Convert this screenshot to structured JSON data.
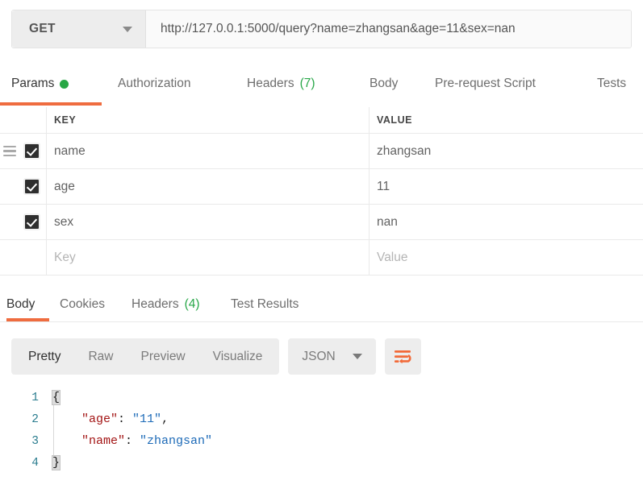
{
  "request": {
    "method": "GET",
    "method_icon": "chevron-down-icon",
    "url": "http://127.0.0.1:5000/query?name=zhangsan&age=11&sex=nan",
    "url_placeholder": "Enter request URL",
    "tabs": [
      {
        "label": "Params",
        "badge": "",
        "dot": true,
        "active": true
      },
      {
        "label": "Authorization",
        "badge": "",
        "dot": false,
        "active": false
      },
      {
        "label": "Headers",
        "badge": "(7)",
        "dot": false,
        "active": false
      },
      {
        "label": "Body",
        "badge": "",
        "dot": false,
        "active": false
      },
      {
        "label": "Pre-request Script",
        "badge": "",
        "dot": false,
        "active": false
      },
      {
        "label": "Tests",
        "badge": "",
        "dot": false,
        "active": false
      }
    ]
  },
  "params": {
    "columns": {
      "key": "KEY",
      "value": "VALUE"
    },
    "rows": [
      {
        "key": "name",
        "value": "zhangsan",
        "checked": true,
        "draggable": true
      },
      {
        "key": "age",
        "value": "11",
        "checked": true,
        "draggable": false
      },
      {
        "key": "sex",
        "value": "nan",
        "checked": true,
        "draggable": false
      }
    ],
    "new_row": {
      "key_placeholder": "Key",
      "value_placeholder": "Value"
    }
  },
  "response": {
    "tabs": [
      {
        "label": "Body",
        "badge": "",
        "active": true
      },
      {
        "label": "Cookies",
        "badge": "",
        "active": false
      },
      {
        "label": "Headers",
        "badge": "(4)",
        "active": false
      },
      {
        "label": "Test Results",
        "badge": "",
        "active": false
      }
    ],
    "view_modes": [
      {
        "label": "Pretty",
        "active": true
      },
      {
        "label": "Raw",
        "active": false
      },
      {
        "label": "Preview",
        "active": false
      },
      {
        "label": "Visualize",
        "active": false
      }
    ],
    "format": {
      "selected": "JSON",
      "icon": "chevron-down-icon"
    },
    "wrap_button": {
      "icon": "word-wrap-icon"
    },
    "body_lines": [
      {
        "num": "1",
        "text": "{"
      },
      {
        "num": "2",
        "key": "\"age\"",
        "value": "\"11\"",
        "trail": ","
      },
      {
        "num": "3",
        "key": "\"name\"",
        "value": "\"zhangsan\"",
        "trail": ""
      },
      {
        "num": "4",
        "text": "}"
      }
    ]
  },
  "colors": {
    "accent_orange": "#ef6c3f",
    "badge_green": "#2aa84a",
    "dot_green": "#28a745",
    "json_key_red": "#a31515",
    "json_string_blue": "#1e6bb8",
    "line_number_teal": "#2b7d8f",
    "checkbox_dark": "#2e2e2e"
  }
}
